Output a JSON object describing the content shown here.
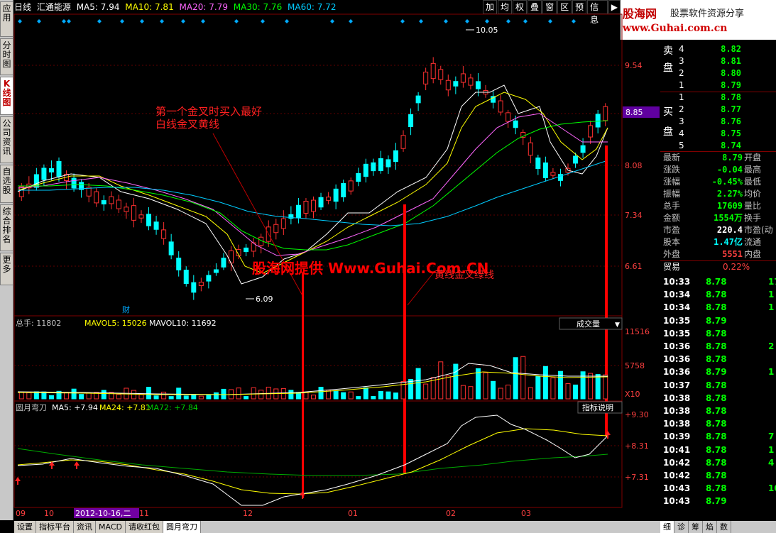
{
  "left_tabs": [
    {
      "label": "应用"
    },
    {
      "label": "分时图"
    },
    {
      "label": "K线图"
    },
    {
      "label": "公司资讯"
    },
    {
      "label": "自选股"
    },
    {
      "label": "综合排名"
    },
    {
      "label": "更多"
    }
  ],
  "header": {
    "period": "日线",
    "name": "汇通能源",
    "ma5": "MA5: 7.94",
    "ma10": "MA10: 7.81",
    "ma20": "MA20: 7.79",
    "ma30": "MA30: 7.76",
    "ma60": "MA60: 7.72"
  },
  "toolbar": [
    "加",
    "均",
    "权",
    "叠",
    "窗",
    "区",
    "预",
    "信息"
  ],
  "brand": {
    "logo": "股海网",
    "slogan": "股票软件资源分享",
    "url": "www.Guhai.com.cn"
  },
  "price_axis": [
    "9.54",
    "8.85",
    "8.08",
    "7.34",
    "6.61"
  ],
  "annotations": {
    "text1": "第一个金叉时买入最好",
    "text2": "白线金叉黄线",
    "watermark": "股海网提供 Www.Guhai.Com.CN",
    "text3": "黄线金叉绿线",
    "high": "10.05",
    "low": "6.09",
    "cai": "财"
  },
  "volume": {
    "title": "总手: 11802",
    "mavol5": "MAVOL5: 15026",
    "mavol10": "MAVOL10: 11692",
    "button": "成交量",
    "axis": [
      "11516",
      "5758",
      "X10"
    ]
  },
  "indicator": {
    "title": "圆月弯刀",
    "ma5": "MA5: +7.94",
    "ma24": "MA24: +7.81",
    "ma72": "MA72: +7.84",
    "button": "指标说明",
    "axis": [
      "+9.30",
      "+8.31",
      "+7.31"
    ]
  },
  "dates": [
    "09",
    "10",
    "2012-10-16,二",
    "11",
    "12",
    "01",
    "02",
    "03"
  ],
  "order_book": {
    "sell_label": "卖盘",
    "buy_label": "买盘",
    "sells": [
      {
        "n": "4",
        "p": "8.82"
      },
      {
        "n": "3",
        "p": "8.81"
      },
      {
        "n": "2",
        "p": "8.80"
      },
      {
        "n": "1",
        "p": "8.79"
      }
    ],
    "buys": [
      {
        "n": "1",
        "p": "8.78"
      },
      {
        "n": "2",
        "p": "8.77"
      },
      {
        "n": "3",
        "p": "8.76"
      },
      {
        "n": "4",
        "p": "8.75"
      },
      {
        "n": "5",
        "p": "8.74"
      }
    ]
  },
  "stats": [
    {
      "k": "最新",
      "v": "8.79",
      "k2": "开盘"
    },
    {
      "k": "涨跌",
      "v": "-0.04",
      "k2": "最高"
    },
    {
      "k": "涨幅",
      "v": "-0.45%",
      "k2": "最低"
    },
    {
      "k": "振幅",
      "v": "2.27%",
      "k2": "均价"
    },
    {
      "k": "总手",
      "v": "17609",
      "k2": "量比"
    },
    {
      "k": "金额",
      "v": "1554万",
      "k2": "换手"
    },
    {
      "k": "市盈",
      "v": "220.4",
      "k2": "市盈(动"
    },
    {
      "k": "股本",
      "v": "1.47亿",
      "k2": "流通"
    },
    {
      "k": "外盘",
      "v": "5551",
      "k2": "内盘"
    }
  ],
  "trade_header": {
    "label": "贸易",
    "pct": "0.22%"
  },
  "trades": [
    {
      "t": "10:33",
      "p": "8.78",
      "n": "17"
    },
    {
      "t": "10:34",
      "p": "8.78",
      "n": "1"
    },
    {
      "t": "10:34",
      "p": "8.78",
      "n": "1"
    },
    {
      "t": "10:35",
      "p": "8.79",
      "n": ""
    },
    {
      "t": "10:35",
      "p": "8.78",
      "n": ""
    },
    {
      "t": "10:36",
      "p": "8.78",
      "n": "2"
    },
    {
      "t": "10:36",
      "p": "8.78",
      "n": ""
    },
    {
      "t": "10:36",
      "p": "8.79",
      "n": "1"
    },
    {
      "t": "10:37",
      "p": "8.78",
      "n": ""
    },
    {
      "t": "10:38",
      "p": "8.78",
      "n": ""
    },
    {
      "t": "10:38",
      "p": "8.78",
      "n": ""
    },
    {
      "t": "10:38",
      "p": "8.78",
      "n": ""
    },
    {
      "t": "10:39",
      "p": "8.78",
      "n": "7"
    },
    {
      "t": "10:41",
      "p": "8.78",
      "n": "1"
    },
    {
      "t": "10:42",
      "p": "8.78",
      "n": "4"
    },
    {
      "t": "10:42",
      "p": "8.78",
      "n": ""
    },
    {
      "t": "10:43",
      "p": "8.78",
      "n": "10"
    },
    {
      "t": "10:43",
      "p": "8.79",
      "n": ""
    }
  ],
  "bottom_tabs": [
    "设置",
    "指标平台",
    "资讯",
    "MACD",
    "请收红包",
    "圆月弯刀"
  ],
  "right_tabs": [
    "细",
    "诊",
    "筹",
    "焰",
    "数"
  ]
}
